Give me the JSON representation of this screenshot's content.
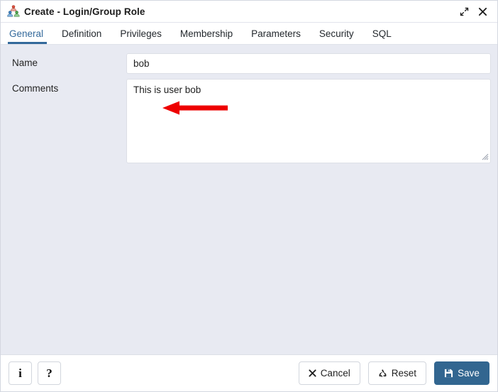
{
  "window": {
    "title": "Create - Login/Group Role",
    "icon": "group-role-icon",
    "controls": {
      "maximize_label": "⤢",
      "close_label": "✕"
    }
  },
  "tabs": [
    {
      "label": "General",
      "active": true
    },
    {
      "label": "Definition",
      "active": false
    },
    {
      "label": "Privileges",
      "active": false
    },
    {
      "label": "Membership",
      "active": false
    },
    {
      "label": "Parameters",
      "active": false
    },
    {
      "label": "Security",
      "active": false
    },
    {
      "label": "SQL",
      "active": false
    }
  ],
  "form": {
    "name": {
      "label": "Name",
      "value": "bob",
      "placeholder": ""
    },
    "comments": {
      "label": "Comments",
      "value": "This is user bob",
      "placeholder": ""
    }
  },
  "annotation": {
    "type": "arrow",
    "direction": "left",
    "color": "#ee0000",
    "points_at": "name-input"
  },
  "footer": {
    "info_label": "i",
    "help_label": "?",
    "cancel_label": "Cancel",
    "reset_label": "Reset",
    "save_label": "Save"
  },
  "colors": {
    "accent": "#326690",
    "body_background": "#e8eaf2",
    "annotation_red": "#ee0000"
  }
}
